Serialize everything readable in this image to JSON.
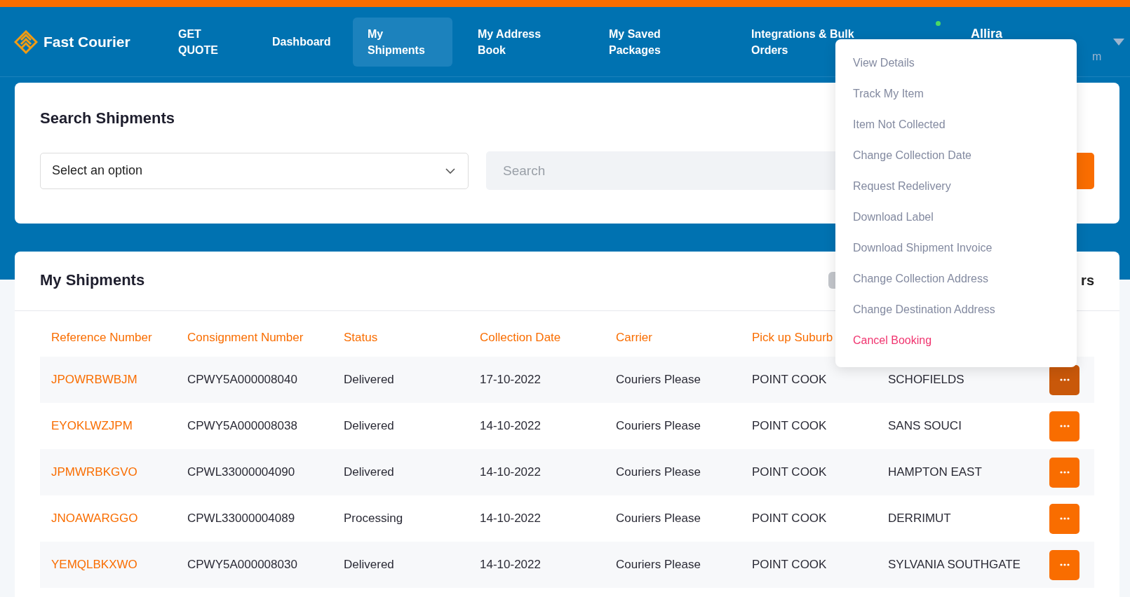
{
  "brand": "Fast Courier",
  "nav": [
    {
      "label": "GET QUOTE",
      "selected": false
    },
    {
      "label": "Dashboard",
      "selected": false
    },
    {
      "label": "My Shipments",
      "selected": true
    },
    {
      "label": "My Address Book",
      "selected": false
    },
    {
      "label": "My Saved Packages",
      "selected": false
    },
    {
      "label": "Integrations & Bulk Orders",
      "selected": false
    }
  ],
  "user": {
    "name": "Allira",
    "subtitle": "m",
    "online": true
  },
  "search": {
    "title": "Search Shipments",
    "select_placeholder": "Select an option",
    "search_placeholder": "Search"
  },
  "shipments": {
    "title": "My Shipments",
    "filter_checked": false,
    "filter_label": "rs",
    "columns": [
      "Reference Number",
      "Consignment Number",
      "Status",
      "Collection Date",
      "Carrier",
      "Pick up Suburb"
    ],
    "rows": [
      {
        "reference": "JPOWRBWBJM",
        "consignment": "CPWY5A000008040",
        "status": "Delivered",
        "collection_date": "17-10-2022",
        "carrier": "Couriers Please",
        "pickup": "POINT COOK",
        "destination": "SCHOFIELDS",
        "selected": true
      },
      {
        "reference": "EYOKLWZJPM",
        "consignment": "CPWY5A000008038",
        "status": "Delivered",
        "collection_date": "14-10-2022",
        "carrier": "Couriers Please",
        "pickup": "POINT COOK",
        "destination": "SANS SOUCI",
        "selected": false
      },
      {
        "reference": "JPMWRBKGVO",
        "consignment": "CPWL33000004090",
        "status": "Delivered",
        "collection_date": "14-10-2022",
        "carrier": "Couriers Please",
        "pickup": "POINT COOK",
        "destination": "HAMPTON EAST",
        "selected": false
      },
      {
        "reference": "JNOAWARGGO",
        "consignment": "CPWL33000004089",
        "status": "Processing",
        "collection_date": "14-10-2022",
        "carrier": "Couriers Please",
        "pickup": "POINT COOK",
        "destination": "DERRIMUT",
        "selected": false
      },
      {
        "reference": "YEMQLBKXWO",
        "consignment": "CPWY5A000008030",
        "status": "Delivered",
        "collection_date": "14-10-2022",
        "carrier": "Couriers Please",
        "pickup": "POINT COOK",
        "destination": "SYLVANIA SOUTHGATE",
        "selected": false
      }
    ]
  },
  "menu": [
    {
      "label": "View Details",
      "kind": "normal"
    },
    {
      "label": "Track My Item",
      "kind": "normal"
    },
    {
      "label": "Item Not Collected",
      "kind": "normal"
    },
    {
      "label": "Change Collection Date",
      "kind": "normal"
    },
    {
      "label": "Request Redelivery",
      "kind": "normal"
    },
    {
      "label": "Download Label",
      "kind": "normal"
    },
    {
      "label": "Download Shipment Invoice",
      "kind": "normal"
    },
    {
      "label": "Change Collection Address",
      "kind": "normal"
    },
    {
      "label": "Change Destination Address",
      "kind": "normal"
    },
    {
      "label": "Cancel Booking",
      "kind": "danger"
    }
  ]
}
